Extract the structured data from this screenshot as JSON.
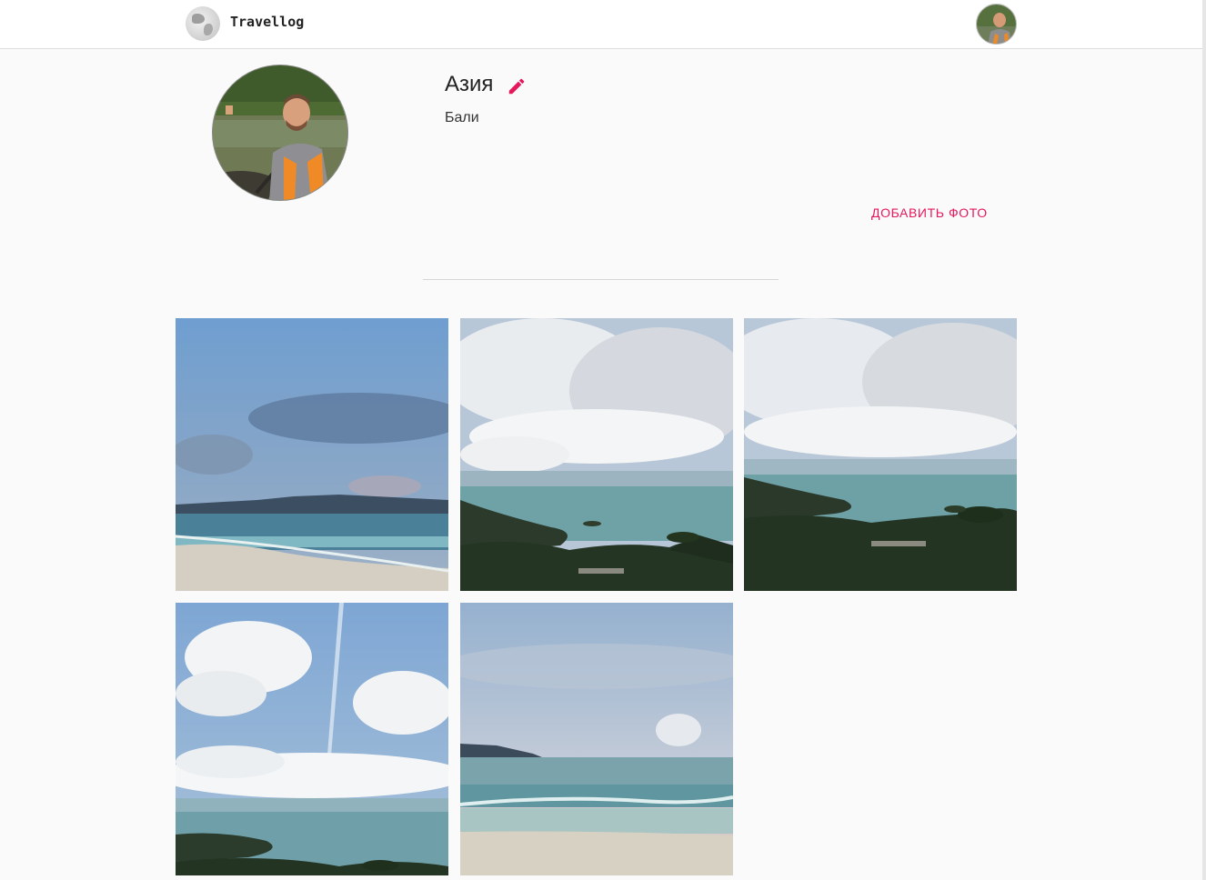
{
  "header": {
    "logo_text": "Travellog",
    "logo_icon": "globe-icon",
    "avatar_icon": "user-avatar"
  },
  "album": {
    "title": "Азия",
    "description": "Бали",
    "edit_icon": "pencil-icon",
    "add_photo_label": "ДОБАВИТЬ ФОТО"
  },
  "colors": {
    "accent": "#e5185c",
    "background": "#fafafa",
    "header_bg": "#ffffff"
  },
  "photos": [
    {
      "scene": "beach-dusk"
    },
    {
      "scene": "bay-clouds"
    },
    {
      "scene": "bay-clouds-2"
    },
    {
      "scene": "sky-islands"
    },
    {
      "scene": "sea-evening"
    }
  ]
}
